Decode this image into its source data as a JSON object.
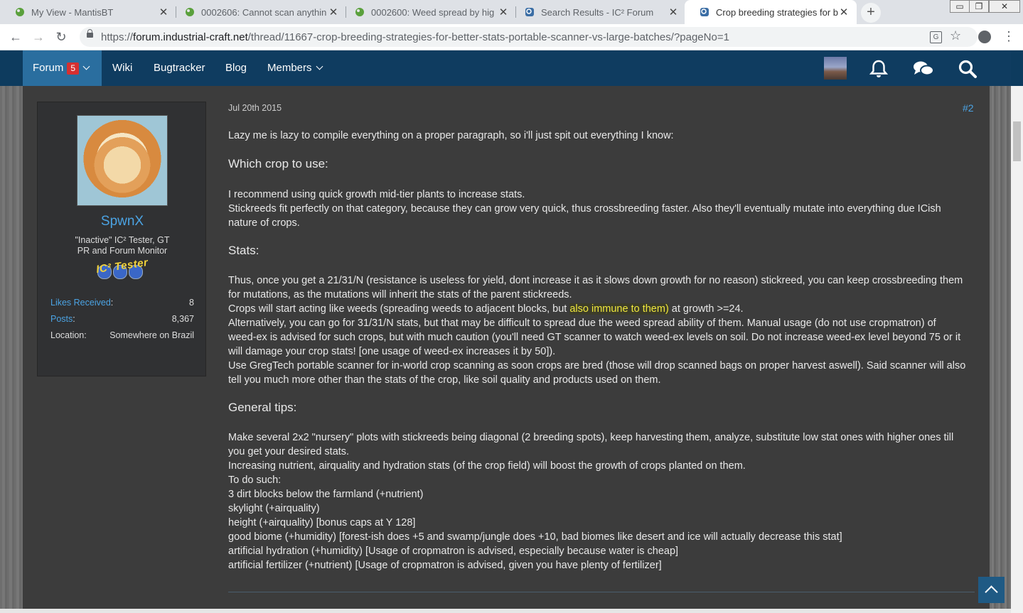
{
  "browser": {
    "tabs": [
      {
        "title": "My View - MantisBT",
        "active": false
      },
      {
        "title": "0002606: Cannot scan anythin",
        "active": false
      },
      {
        "title": "0002600: Weed spread by hig",
        "active": false
      },
      {
        "title": "Search Results - IC² Forum",
        "active": false
      },
      {
        "title": "Crop breeding strategies for b",
        "active": true
      }
    ],
    "url_domain": "forum.industrial-craft.net",
    "url_path": "/thread/11667-crop-breeding-strategies-for-better-stats-portable-scanner-vs-large-batches/?pageNo=1",
    "url_scheme": "https://"
  },
  "nav": {
    "forum": "Forum",
    "forum_badge": "5",
    "wiki": "Wiki",
    "bugtracker": "Bugtracker",
    "blog": "Blog",
    "members": "Members"
  },
  "author": {
    "name": "SpwnX",
    "title": "\"Inactive\" IC² Tester, GT PR and Forum Monitor",
    "rank_badge": "IC² Tester",
    "stats": [
      {
        "label": "Likes Received",
        "value": "8"
      },
      {
        "label": "Posts",
        "value": "8,367"
      },
      {
        "label": "Location",
        "value": "Somewhere on Brazil"
      }
    ]
  },
  "post": {
    "date": "Jul 20th 2015",
    "number": "#2",
    "intro": "Lazy me is lazy to compile everything on a proper paragraph, so i'll just spit out everything I know:",
    "h1": "Which crop to use:",
    "s1_l1": "I recommend using quick growth mid-tier plants to increase stats.",
    "s1_l2": "Stickreeds fit perfectly on that category, because they can grow very quick, thus crossbreeding faster. Also they'll eventually mutate into everything due ICish",
    "s1_l3": "nature of crops.",
    "h2": "Stats:",
    "s2_l1": "Thus, once you get a 21/31/N (resistance is useless for yield, dont increase it as it slows down growth for no reason) stickreed, you can keep crossbreeding them",
    "s2_l2": "for mutations, as the mutations will inherit the stats of the parent stickreeds.",
    "s2_l3a": "Crops will start acting like weeds (spreading weeds to adjacent blocks, but ",
    "s2_l3hl": "also immune to them)",
    "s2_l3b": " at growth >=24.",
    "s2_l4": "Alternatively, you can go for 31/31/N stats, but that may be difficult to spread due the weed spread ability of them. Manual usage (do not use cropmatron) of",
    "s2_l5": "weed-ex is advised for such crops, but with much caution (you'll need GT scanner to watch weed-ex levels on soil. Do not increase weed-ex level beyond 75 or it",
    "s2_l6": "will damage your crop stats! [one usage of weed-ex increases it by 50]).",
    "s2_l7": "Use GregTech portable scanner for in-world crop scanning as soon crops are bred (those will drop scanned bags on proper harvest aswell). Said scanner will also",
    "s2_l8": "tell you much more other than the stats of the crop, like soil quality and products used on them.",
    "h3": "General tips:",
    "s3_l1": "Make several 2x2 \"nursery\" plots with stickreeds being diagonal (2 breeding spots), keep harvesting them, analyze, substitute low stat ones with higher ones till",
    "s3_l2": "you get your desired stats.",
    "s3_l3": "Increasing nutrient, airquality and hydration stats (of the crop field) will boost the growth of crops planted on them.",
    "s3_l4": "To do such:",
    "s3_l5": "3 dirt blocks below the farmland (+nutrient)",
    "s3_l6": "skylight (+airquality)",
    "s3_l7": "height (+airquality) [bonus caps at Y 128]",
    "s3_l8": "good biome (+humidity) [forest-ish does +5 and swamp/jungle does +10, bad biomes like desert and ice will actually decrease this stat]",
    "s3_l9": "artificial hydration (+humidity) [Usage of cropmatron is advised, especially because water is cheap]",
    "s3_l10": "artificial fertilizer (+nutrient) [Usage of cropmatron is advised, given you have plenty of fertilizer]"
  },
  "colors": {
    "nav_bg": "#0f3c60",
    "nav_active": "#2a6e9f",
    "link": "#4ba3e3",
    "highlight": "#f0e83c"
  }
}
